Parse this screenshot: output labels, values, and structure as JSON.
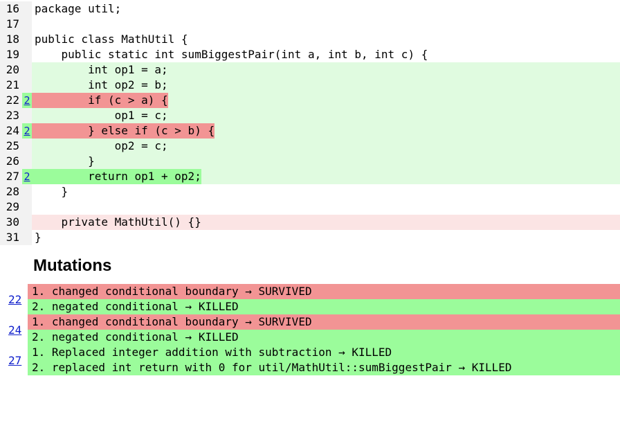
{
  "code": {
    "lines": [
      {
        "n": "16",
        "badge": "",
        "badgeBg": "grey",
        "codeBg": "none",
        "tailBg": "none",
        "text": "package util;"
      },
      {
        "n": "17",
        "badge": "",
        "badgeBg": "grey",
        "codeBg": "none",
        "tailBg": "none",
        "text": ""
      },
      {
        "n": "18",
        "badge": "",
        "badgeBg": "grey",
        "codeBg": "none",
        "tailBg": "none",
        "text": "public class MathUtil {"
      },
      {
        "n": "19",
        "badge": "",
        "badgeBg": "grey",
        "codeBg": "none",
        "tailBg": "none",
        "text": "    public static int sumBiggestPair(int a, int b, int c) {"
      },
      {
        "n": "20",
        "badge": "",
        "badgeBg": "grey",
        "codeBg": "lightgreen",
        "tailBg": "lightgreen",
        "text": "        int op1 = a;"
      },
      {
        "n": "21",
        "badge": "",
        "badgeBg": "grey",
        "codeBg": "lightgreen",
        "tailBg": "lightgreen",
        "text": "        int op2 = b;"
      },
      {
        "n": "22",
        "badge": "2",
        "badgeBg": "green",
        "codeBg": "red",
        "tailBg": "lightgreen",
        "text": "        if (c > a) {"
      },
      {
        "n": "23",
        "badge": "",
        "badgeBg": "grey",
        "codeBg": "lightgreen",
        "tailBg": "lightgreen",
        "text": "            op1 = c;"
      },
      {
        "n": "24",
        "badge": "2",
        "badgeBg": "green",
        "codeBg": "red",
        "tailBg": "lightgreen",
        "text": "        } else if (c > b) {"
      },
      {
        "n": "25",
        "badge": "",
        "badgeBg": "grey",
        "codeBg": "lightgreen",
        "tailBg": "lightgreen",
        "text": "            op2 = c;"
      },
      {
        "n": "26",
        "badge": "",
        "badgeBg": "grey",
        "codeBg": "lightgreen",
        "tailBg": "lightgreen",
        "text": "        }"
      },
      {
        "n": "27",
        "badge": "2",
        "badgeBg": "green",
        "codeBg": "green",
        "tailBg": "lightgreen",
        "text": "        return op1 + op2;"
      },
      {
        "n": "28",
        "badge": "",
        "badgeBg": "grey",
        "codeBg": "none",
        "tailBg": "none",
        "text": "    }"
      },
      {
        "n": "29",
        "badge": "",
        "badgeBg": "grey",
        "codeBg": "none",
        "tailBg": "none",
        "text": ""
      },
      {
        "n": "30",
        "badge": "",
        "badgeBg": "grey",
        "codeBg": "lightpink",
        "tailBg": "lightpink",
        "text": "    private MathUtil() {}"
      },
      {
        "n": "31",
        "badge": "",
        "badgeBg": "grey",
        "codeBg": "none",
        "tailBg": "none",
        "text": "}"
      }
    ]
  },
  "mutations": {
    "header": "Mutations",
    "groups": [
      {
        "line": "22",
        "items": [
          {
            "status": "survived",
            "text": "1. changed conditional boundary → SURVIVED"
          },
          {
            "status": "killed",
            "text": "2. negated conditional → KILLED"
          }
        ]
      },
      {
        "line": "24",
        "items": [
          {
            "status": "survived",
            "text": "1. changed conditional boundary → SURVIVED"
          },
          {
            "status": "killed",
            "text": "2. negated conditional → KILLED"
          }
        ]
      },
      {
        "line": "27",
        "items": [
          {
            "status": "killed",
            "text": "1. Replaced integer addition with subtraction → KILLED"
          },
          {
            "status": "killed",
            "text": "2. replaced int return with 0 for util/MathUtil::sumBiggestPair → KILLED"
          }
        ]
      }
    ]
  }
}
